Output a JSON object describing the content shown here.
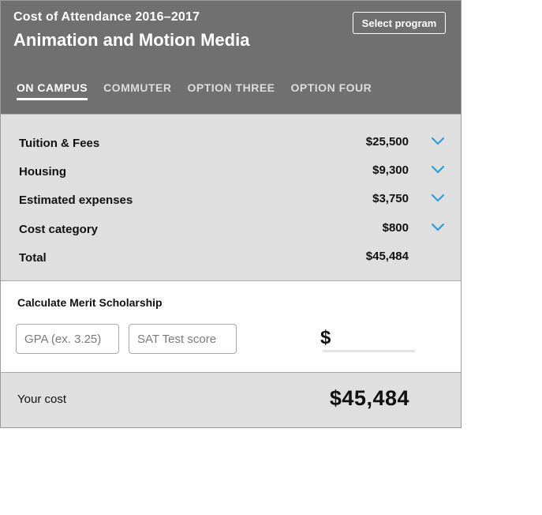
{
  "header": {
    "subtitle": "Cost of Attendance 2016–2017",
    "title": "Animation and Motion Media",
    "select_button": "Select program",
    "tabs": [
      {
        "label": "ON CAMPUS",
        "active": true
      },
      {
        "label": "COMMUTER",
        "active": false
      },
      {
        "label": "OPTION THREE",
        "active": false
      },
      {
        "label": "OPTION FOUR",
        "active": false
      }
    ]
  },
  "costs": {
    "rows": [
      {
        "label": "Tuition & Fees",
        "amount": "$25,500",
        "icon": "chevron-down-icon"
      },
      {
        "label": "Housing",
        "amount": "$9,300",
        "icon": "chevron-down-icon"
      },
      {
        "label": "Estimated expenses",
        "amount": "$3,750",
        "icon": "chevron-down-icon"
      },
      {
        "label": "Cost category",
        "amount": "$800",
        "icon": "chevron-down-icon"
      }
    ],
    "total": {
      "label": "Total",
      "amount": "$45,484"
    }
  },
  "scholarship": {
    "title": "Calculate Merit Scholarship",
    "gpa_placeholder": "GPA (ex. 3.25)",
    "gpa_value": "",
    "sat_placeholder": "SAT Test score",
    "sat_value": "",
    "currency_symbol": "$",
    "award_value": ""
  },
  "your_cost": {
    "label": "Your cost",
    "amount": "$45,484"
  },
  "colors": {
    "header_bg": "#707070",
    "panel_bg": "#dfdfdf",
    "chevron": "#2a9fd8"
  }
}
